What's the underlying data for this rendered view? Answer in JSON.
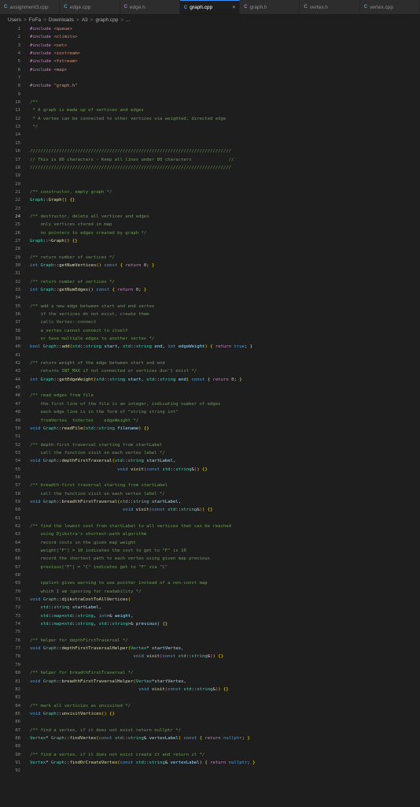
{
  "tabs": [
    {
      "label": "assignment3.cpp",
      "kind": "cpp",
      "active": false
    },
    {
      "label": "edge.cpp",
      "kind": "cpp",
      "active": false
    },
    {
      "label": "edge.h",
      "kind": "h",
      "active": false
    },
    {
      "label": "graph.cpp",
      "kind": "cpp",
      "active": true
    },
    {
      "label": "graph.h",
      "kind": "h",
      "active": false
    },
    {
      "label": "vertex.h",
      "kind": "h",
      "active": false
    },
    {
      "label": "vertex.cpp",
      "kind": "cpp",
      "active": false
    }
  ],
  "close_glyph": "×",
  "breadcrumb": [
    "Users",
    "FoFa",
    "Downloads",
    "A3",
    "graph.cpp",
    "..."
  ],
  "breadcrumb_sep": ">",
  "current_line": 24,
  "lines": [
    [
      [
        "pp",
        "#include "
      ],
      [
        "inc",
        "<queue>"
      ]
    ],
    [
      [
        "pp",
        "#include "
      ],
      [
        "inc",
        "<climits>"
      ]
    ],
    [
      [
        "pp",
        "#include "
      ],
      [
        "inc",
        "<set>"
      ]
    ],
    [
      [
        "pp",
        "#include "
      ],
      [
        "inc",
        "<iostream>"
      ]
    ],
    [
      [
        "pp",
        "#include "
      ],
      [
        "inc",
        "<fstream>"
      ]
    ],
    [
      [
        "pp",
        "#include "
      ],
      [
        "inc",
        "<map>"
      ]
    ],
    [],
    [
      [
        "pp",
        "#include "
      ],
      [
        "inc",
        "\"graph.h\""
      ]
    ],
    [],
    [
      [
        "cm",
        "/**"
      ]
    ],
    [
      [
        "cm",
        " * A graph is made up of vertices and edges"
      ]
    ],
    [
      [
        "cm",
        " * A vertex can be connected to other vertices via weighted, directed edge"
      ]
    ],
    [
      [
        "cm",
        " */"
      ]
    ],
    [],
    [],
    [
      [
        "cm",
        "////////////////////////////////////////////////////////////////////////////"
      ]
    ],
    [
      [
        "cm",
        "// This is 80 characters - Keep all lines under 80 characters              //"
      ]
    ],
    [
      [
        "cm",
        "////////////////////////////////////////////////////////////////////////////"
      ]
    ],
    [],
    [],
    [
      [
        "cm",
        "/** constructor, empty graph */"
      ]
    ],
    [
      [
        "ty",
        "Graph"
      ],
      [
        "pu",
        "::"
      ],
      [
        "fn",
        "Graph"
      ],
      [
        "br",
        "()"
      ],
      [
        "pu",
        " "
      ],
      [
        "br",
        "{}"
      ]
    ],
    [],
    [
      [
        "cm",
        "/** destructor, delete all vertices and edges"
      ]
    ],
    [
      [
        "cm",
        "    only vertices stored in map"
      ]
    ],
    [
      [
        "cm",
        "    no pointers to edges created by graph */"
      ]
    ],
    [
      [
        "ty",
        "Graph"
      ],
      [
        "pu",
        "::~"
      ],
      [
        "fn",
        "Graph"
      ],
      [
        "br",
        "()"
      ],
      [
        "pu",
        " "
      ],
      [
        "br",
        "{}"
      ]
    ],
    [],
    [
      [
        "cm",
        "/** return number of vertices */"
      ]
    ],
    [
      [
        "kw",
        "int "
      ],
      [
        "ty",
        "Graph"
      ],
      [
        "pu",
        "::"
      ],
      [
        "fn",
        "getNumVertices"
      ],
      [
        "br",
        "()"
      ],
      [
        "kw",
        " const "
      ],
      [
        "br",
        "{ "
      ],
      [
        "pp",
        "return "
      ],
      [
        "nu",
        "0"
      ],
      [
        "pu",
        "; "
      ],
      [
        "br",
        "}"
      ]
    ],
    [],
    [
      [
        "cm",
        "/** return number of vertices */"
      ]
    ],
    [
      [
        "kw",
        "int "
      ],
      [
        "ty",
        "Graph"
      ],
      [
        "pu",
        "::"
      ],
      [
        "fn",
        "getNumEdges"
      ],
      [
        "br",
        "()"
      ],
      [
        "kw",
        " const "
      ],
      [
        "br",
        "{ "
      ],
      [
        "pp",
        "return "
      ],
      [
        "nu",
        "0"
      ],
      [
        "pu",
        "; "
      ],
      [
        "br",
        "}"
      ]
    ],
    [],
    [
      [
        "cm",
        "/** add a new edge between start and end vertex"
      ]
    ],
    [
      [
        "cm",
        "    if the vertices do not exist, create them"
      ]
    ],
    [
      [
        "cm",
        "    calls Vertex::connect"
      ]
    ],
    [
      [
        "cm",
        "    a vertex cannot connect to itself"
      ]
    ],
    [
      [
        "cm",
        "    or have multiple edges to another vertex */"
      ]
    ],
    [
      [
        "kw",
        "bool "
      ],
      [
        "ty",
        "Graph"
      ],
      [
        "pu",
        "::"
      ],
      [
        "fn",
        "add"
      ],
      [
        "br",
        "("
      ],
      [
        "ty",
        "std"
      ],
      [
        "pu",
        "::"
      ],
      [
        "ty",
        "string "
      ],
      [
        "va",
        "start"
      ],
      [
        "pu",
        ", "
      ],
      [
        "ty",
        "std"
      ],
      [
        "pu",
        "::"
      ],
      [
        "ty",
        "string "
      ],
      [
        "va",
        "end"
      ],
      [
        "pu",
        ", "
      ],
      [
        "kw",
        "int "
      ],
      [
        "va",
        "edgeWeight"
      ],
      [
        "br",
        ")"
      ],
      [
        "pu",
        " "
      ],
      [
        "br",
        "{ "
      ],
      [
        "pp",
        "return "
      ],
      [
        "kw",
        "true"
      ],
      [
        "pu",
        "; "
      ],
      [
        "br",
        "}"
      ]
    ],
    [],
    [
      [
        "cm",
        "/** return weight of the edge between start and end"
      ]
    ],
    [
      [
        "cm",
        "    returns INT_MAX if not connected or vertices don't exist */"
      ]
    ],
    [
      [
        "kw",
        "int "
      ],
      [
        "ty",
        "Graph"
      ],
      [
        "pu",
        "::"
      ],
      [
        "fn",
        "getEdgeWeight"
      ],
      [
        "br",
        "("
      ],
      [
        "ty",
        "std"
      ],
      [
        "pu",
        "::"
      ],
      [
        "ty",
        "string "
      ],
      [
        "va",
        "start"
      ],
      [
        "pu",
        ", "
      ],
      [
        "ty",
        "std"
      ],
      [
        "pu",
        "::"
      ],
      [
        "ty",
        "string "
      ],
      [
        "va",
        "end"
      ],
      [
        "br",
        ")"
      ],
      [
        "kw",
        " const "
      ],
      [
        "br",
        "{ "
      ],
      [
        "pp",
        "return "
      ],
      [
        "nu",
        "0"
      ],
      [
        "pu",
        "; "
      ],
      [
        "br",
        "}"
      ]
    ],
    [],
    [
      [
        "cm",
        "/** read edges from file"
      ]
    ],
    [
      [
        "cm",
        "    the first line of the file is an integer, indicating number of edges"
      ]
    ],
    [
      [
        "cm",
        "    each edge line is in the form of \"string string int\""
      ]
    ],
    [
      [
        "cm",
        "    fromVertex  toVertex    edgeWeight */"
      ]
    ],
    [
      [
        "kw",
        "void "
      ],
      [
        "ty",
        "Graph"
      ],
      [
        "pu",
        "::"
      ],
      [
        "fn",
        "readFile"
      ],
      [
        "br",
        "("
      ],
      [
        "ty",
        "std"
      ],
      [
        "pu",
        "::"
      ],
      [
        "ty",
        "string "
      ],
      [
        "va",
        "filename"
      ],
      [
        "br",
        ")"
      ],
      [
        "pu",
        " "
      ],
      [
        "br",
        "{}"
      ]
    ],
    [],
    [
      [
        "cm",
        "/** depth-first traversal starting from startLabel"
      ]
    ],
    [
      [
        "cm",
        "    call the function visit on each vertex label */"
      ]
    ],
    [
      [
        "kw",
        "void "
      ],
      [
        "ty",
        "Graph"
      ],
      [
        "pu",
        "::"
      ],
      [
        "fn",
        "depthFirstTraversal"
      ],
      [
        "br",
        "("
      ],
      [
        "ty",
        "std"
      ],
      [
        "pu",
        "::"
      ],
      [
        "ty",
        "string "
      ],
      [
        "va",
        "startLabel"
      ],
      [
        "pu",
        ","
      ]
    ],
    [
      [
        "pu",
        "                                 "
      ],
      [
        "kw",
        "void "
      ],
      [
        "fn",
        "visit"
      ],
      [
        "br2",
        "("
      ],
      [
        "kw",
        "const "
      ],
      [
        "ty",
        "std"
      ],
      [
        "pu",
        "::"
      ],
      [
        "ty",
        "string"
      ],
      [
        "op",
        "&"
      ],
      [
        "br2",
        ")"
      ],
      [
        "br",
        ")"
      ],
      [
        "pu",
        " "
      ],
      [
        "br",
        "{}"
      ]
    ],
    [],
    [
      [
        "cm",
        "/** breadth-first traversal starting from startLabel"
      ]
    ],
    [
      [
        "cm",
        "    call the function visit on each vertex label */"
      ]
    ],
    [
      [
        "kw",
        "void "
      ],
      [
        "ty",
        "Graph"
      ],
      [
        "pu",
        "::"
      ],
      [
        "fn",
        "breadthFirstTraversal"
      ],
      [
        "br",
        "("
      ],
      [
        "ty",
        "std"
      ],
      [
        "pu",
        "::"
      ],
      [
        "ty",
        "string "
      ],
      [
        "va",
        "startLabel"
      ],
      [
        "pu",
        ","
      ]
    ],
    [
      [
        "pu",
        "                                   "
      ],
      [
        "kw",
        "void "
      ],
      [
        "fn",
        "visit"
      ],
      [
        "br2",
        "("
      ],
      [
        "kw",
        "const "
      ],
      [
        "ty",
        "std"
      ],
      [
        "pu",
        "::"
      ],
      [
        "ty",
        "string"
      ],
      [
        "op",
        "&"
      ],
      [
        "br2",
        ")"
      ],
      [
        "br",
        ")"
      ],
      [
        "pu",
        " "
      ],
      [
        "br",
        "{}"
      ]
    ],
    [],
    [
      [
        "cm",
        "/** find the lowest cost from startLabel to all vertices that can be reached"
      ]
    ],
    [
      [
        "cm",
        "    using Djikstra's shortest-path algorithm"
      ]
    ],
    [
      [
        "cm",
        "    record costs in the given map weight"
      ]
    ],
    [
      [
        "cm",
        "    weight[\"F\"] = 10 indicates the cost to get to \"F\" is 10"
      ]
    ],
    [
      [
        "cm",
        "    record the shortest path to each vertex using given map previous"
      ]
    ],
    [
      [
        "cm",
        "    previous[\"F\"] = \"C\" indicates get to \"F\" via \"C\""
      ]
    ],
    [],
    [
      [
        "cm",
        "    cpplint gives warning to use pointer instead of a non-const map"
      ]
    ],
    [
      [
        "cm",
        "    which I am ignoring for readability */"
      ]
    ],
    [
      [
        "kw",
        "void "
      ],
      [
        "ty",
        "Graph"
      ],
      [
        "pu",
        "::"
      ],
      [
        "fn",
        "djikstraCostToAllVertices"
      ],
      [
        "br",
        "("
      ]
    ],
    [
      [
        "pu",
        "    "
      ],
      [
        "ty",
        "std"
      ],
      [
        "pu",
        "::"
      ],
      [
        "ty",
        "string "
      ],
      [
        "va",
        "startLabel"
      ],
      [
        "pu",
        ","
      ]
    ],
    [
      [
        "pu",
        "    "
      ],
      [
        "ty",
        "std"
      ],
      [
        "pu",
        "::"
      ],
      [
        "ty",
        "map"
      ],
      [
        "op",
        "<"
      ],
      [
        "ty",
        "std"
      ],
      [
        "pu",
        "::"
      ],
      [
        "ty",
        "string"
      ],
      [
        "pu",
        ", "
      ],
      [
        "kw",
        "int"
      ],
      [
        "op",
        ">&"
      ],
      [
        "va",
        " weight"
      ],
      [
        "pu",
        ","
      ]
    ],
    [
      [
        "pu",
        "    "
      ],
      [
        "ty",
        "std"
      ],
      [
        "pu",
        "::"
      ],
      [
        "ty",
        "map"
      ],
      [
        "op",
        "<"
      ],
      [
        "ty",
        "std"
      ],
      [
        "pu",
        "::"
      ],
      [
        "ty",
        "string"
      ],
      [
        "pu",
        ", "
      ],
      [
        "ty",
        "std"
      ],
      [
        "pu",
        "::"
      ],
      [
        "ty",
        "string"
      ],
      [
        "op",
        ">&"
      ],
      [
        "va",
        " previous"
      ],
      [
        "br",
        ")"
      ],
      [
        "pu",
        " "
      ],
      [
        "br",
        "{}"
      ]
    ],
    [],
    [
      [
        "cm",
        "/** helper for depthFirstTraversal */"
      ]
    ],
    [
      [
        "kw",
        "void "
      ],
      [
        "ty",
        "Graph"
      ],
      [
        "pu",
        "::"
      ],
      [
        "fn",
        "depthFirstTraversalHelper"
      ],
      [
        "br",
        "("
      ],
      [
        "ty",
        "Vertex"
      ],
      [
        "op",
        "* "
      ],
      [
        "va",
        "startVertex"
      ],
      [
        "pu",
        ","
      ]
    ],
    [
      [
        "pu",
        "                                       "
      ],
      [
        "kw",
        "void "
      ],
      [
        "fn",
        "visit"
      ],
      [
        "br2",
        "("
      ],
      [
        "kw",
        "const "
      ],
      [
        "ty",
        "std"
      ],
      [
        "pu",
        "::"
      ],
      [
        "ty",
        "string"
      ],
      [
        "op",
        "&"
      ],
      [
        "br2",
        ")"
      ],
      [
        "br",
        ")"
      ],
      [
        "pu",
        " "
      ],
      [
        "br",
        "{}"
      ]
    ],
    [],
    [
      [
        "cm",
        "/** helper for breadthFirstTraversal */"
      ]
    ],
    [
      [
        "kw",
        "void "
      ],
      [
        "ty",
        "Graph"
      ],
      [
        "pu",
        "::"
      ],
      [
        "fn",
        "breadthFirstTraversalHelper"
      ],
      [
        "br",
        "("
      ],
      [
        "ty",
        "Vertex"
      ],
      [
        "op",
        "*"
      ],
      [
        "va",
        "startVertex"
      ],
      [
        "pu",
        ","
      ]
    ],
    [
      [
        "pu",
        "                                         "
      ],
      [
        "kw",
        "void "
      ],
      [
        "fn",
        "visit"
      ],
      [
        "br2",
        "("
      ],
      [
        "kw",
        "const "
      ],
      [
        "ty",
        "std"
      ],
      [
        "pu",
        "::"
      ],
      [
        "ty",
        "string"
      ],
      [
        "op",
        "&"
      ],
      [
        "br2",
        ")"
      ],
      [
        "br",
        ")"
      ],
      [
        "pu",
        " "
      ],
      [
        "br",
        "{}"
      ]
    ],
    [],
    [
      [
        "cm",
        "/** mark all verticies as unvisited */"
      ]
    ],
    [
      [
        "kw",
        "void "
      ],
      [
        "ty",
        "Graph"
      ],
      [
        "pu",
        "::"
      ],
      [
        "fn",
        "unvisitVertices"
      ],
      [
        "br",
        "()"
      ],
      [
        "pu",
        " "
      ],
      [
        "br",
        "{}"
      ]
    ],
    [],
    [
      [
        "cm",
        "/** find a vertex, if it does not exist return nullptr */"
      ]
    ],
    [
      [
        "ty",
        "Vertex"
      ],
      [
        "op",
        "* "
      ],
      [
        "ty",
        "Graph"
      ],
      [
        "pu",
        "::"
      ],
      [
        "fn",
        "findVertex"
      ],
      [
        "br",
        "("
      ],
      [
        "kw",
        "const "
      ],
      [
        "ty",
        "std"
      ],
      [
        "pu",
        "::"
      ],
      [
        "ty",
        "string"
      ],
      [
        "op",
        "& "
      ],
      [
        "va",
        "vertexLabel"
      ],
      [
        "br",
        ")"
      ],
      [
        "kw",
        " const "
      ],
      [
        "br",
        "{ "
      ],
      [
        "pp",
        "return "
      ],
      [
        "kw",
        "nullptr"
      ],
      [
        "pu",
        "; "
      ],
      [
        "br",
        "}"
      ]
    ],
    [],
    [
      [
        "cm",
        "/** find a vertex, if it does not exist create it and return it */"
      ]
    ],
    [
      [
        "ty",
        "Vertex"
      ],
      [
        "op",
        "* "
      ],
      [
        "ty",
        "Graph"
      ],
      [
        "pu",
        "::"
      ],
      [
        "fn",
        "findOrCreateVertex"
      ],
      [
        "br",
        "("
      ],
      [
        "kw",
        "const "
      ],
      [
        "ty",
        "std"
      ],
      [
        "pu",
        "::"
      ],
      [
        "ty",
        "string"
      ],
      [
        "op",
        "& "
      ],
      [
        "va",
        "vertexLabel"
      ],
      [
        "br",
        ")"
      ],
      [
        "pu",
        " "
      ],
      [
        "br",
        "{ "
      ],
      [
        "pp",
        "return "
      ],
      [
        "kw",
        "nullptr"
      ],
      [
        "pu",
        "; "
      ],
      [
        "br",
        "}"
      ]
    ],
    []
  ]
}
